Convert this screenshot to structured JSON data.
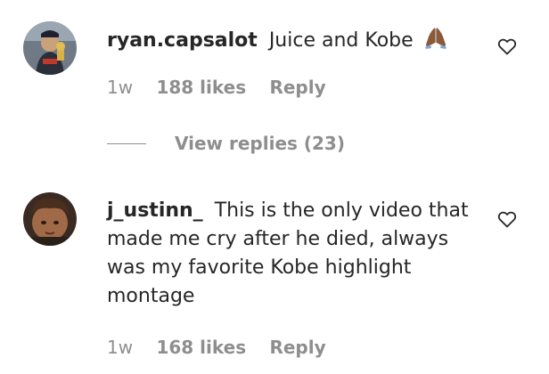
{
  "comments": [
    {
      "username": "ryan.capsalot",
      "text": "Juice and Kobe",
      "emoji": "folded-hands-icon",
      "time": "1w",
      "likes": "188 likes",
      "reply_label": "Reply",
      "view_replies": "View replies (23)"
    },
    {
      "username": "j_ustinn_",
      "text": "This is the only video that made me cry after he died, always was my favorite Kobe highlight montage",
      "time": "1w",
      "likes": "168 likes",
      "reply_label": "Reply"
    }
  ],
  "colors": {
    "text": "#262626",
    "secondary": "#8e8e8e"
  }
}
